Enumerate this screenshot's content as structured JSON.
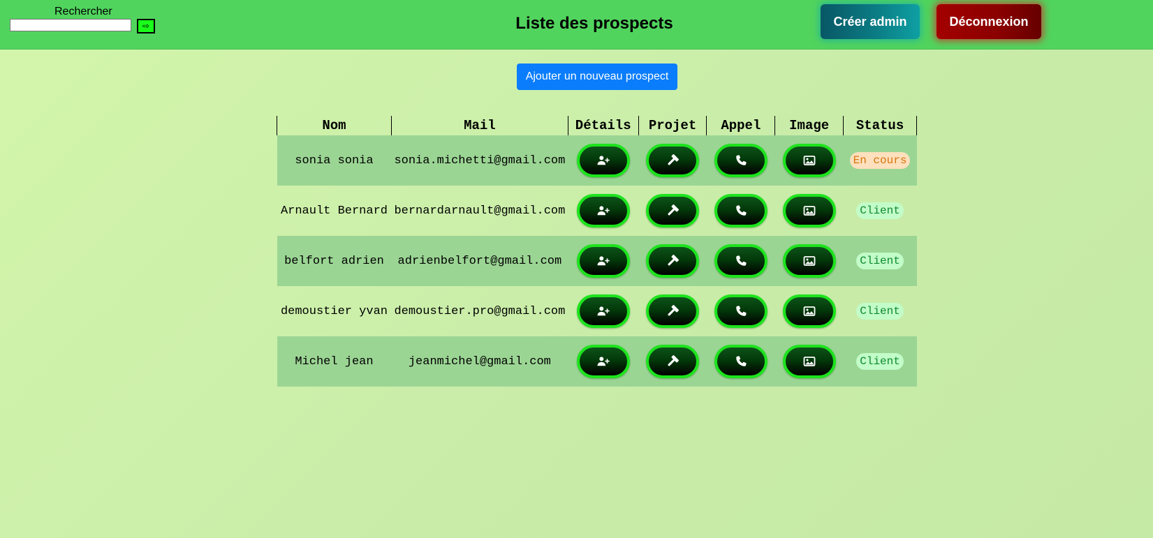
{
  "header": {
    "search_label": "Rechercher",
    "search_value": "",
    "search_button": "⇨",
    "title": "Liste des prospects",
    "admin_button": "Créer admin",
    "logout_button": "Déconnexion"
  },
  "actions": {
    "add_prospect": "Ajouter un nouveau prospect"
  },
  "table": {
    "columns": [
      "Nom",
      "Mail",
      "Détails",
      "Projet",
      "Appel",
      "Image",
      "Status"
    ],
    "row_icons": [
      "user-plus-icon",
      "hammer-icon",
      "phone-icon",
      "image-icon"
    ],
    "rows": [
      {
        "nom": "sonia sonia",
        "mail": "sonia.michetti@gmail.com",
        "status": "En cours"
      },
      {
        "nom": "Arnault Bernard",
        "mail": "bernardarnault@gmail.com",
        "status": "Client"
      },
      {
        "nom": "belfort adrien",
        "mail": "adrienbelfort@gmail.com",
        "status": "Client"
      },
      {
        "nom": "demoustier yvan",
        "mail": "demoustier.pro@gmail.com",
        "status": "Client"
      },
      {
        "nom": "Michel jean",
        "mail": "jeanmichel@gmail.com",
        "status": "Client"
      }
    ]
  },
  "colors": {
    "header_bg": "#51d45e",
    "page_bg": "#cdefab",
    "row_stripe": "#9bd594",
    "pill_border": "#1de31d",
    "primary_blue": "#0a7dfc",
    "status_en_cours_bg": "#fde0bd",
    "status_en_cours_text": "#d9750c",
    "status_client_bg": "#c2fcc8",
    "status_client_text": "#0e8a31"
  }
}
